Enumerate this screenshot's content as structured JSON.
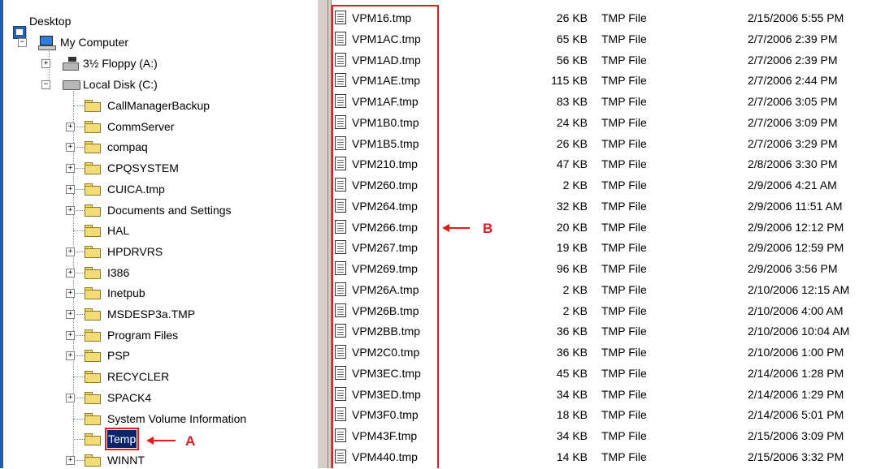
{
  "tree": {
    "desktop": "Desktop",
    "my_computer": "My Computer",
    "floppy": "3½ Floppy (A:)",
    "local_disk": "Local Disk (C:)",
    "folders": [
      {
        "label": "CallManagerBackup",
        "expandable": false
      },
      {
        "label": "CommServer",
        "expandable": true
      },
      {
        "label": "compaq",
        "expandable": true
      },
      {
        "label": "CPQSYSTEM",
        "expandable": true
      },
      {
        "label": "CUICA.tmp",
        "expandable": true
      },
      {
        "label": "Documents and Settings",
        "expandable": true
      },
      {
        "label": "HAL",
        "expandable": false
      },
      {
        "label": "HPDRVRS",
        "expandable": true
      },
      {
        "label": "I386",
        "expandable": true
      },
      {
        "label": "Inetpub",
        "expandable": true
      },
      {
        "label": "MSDESP3a.TMP",
        "expandable": true
      },
      {
        "label": "Program Files",
        "expandable": true
      },
      {
        "label": "PSP",
        "expandable": true
      },
      {
        "label": "RECYCLER",
        "expandable": false
      },
      {
        "label": "SPACK4",
        "expandable": true
      },
      {
        "label": "System Volume Information",
        "expandable": false
      },
      {
        "label": "Temp",
        "expandable": false,
        "selected": true
      },
      {
        "label": "WINNT",
        "expandable": true
      }
    ],
    "expander_plus": "+",
    "expander_minus": "−"
  },
  "files": [
    {
      "name": "VPM16.tmp",
      "size": "26 KB",
      "type": "TMP File",
      "modified": "2/15/2006 5:55 PM"
    },
    {
      "name": "VPM1AC.tmp",
      "size": "65 KB",
      "type": "TMP File",
      "modified": "2/7/2006 2:39 PM"
    },
    {
      "name": "VPM1AD.tmp",
      "size": "56 KB",
      "type": "TMP File",
      "modified": "2/7/2006 2:39 PM"
    },
    {
      "name": "VPM1AE.tmp",
      "size": "115 KB",
      "type": "TMP File",
      "modified": "2/7/2006 2:44 PM"
    },
    {
      "name": "VPM1AF.tmp",
      "size": "83 KB",
      "type": "TMP File",
      "modified": "2/7/2006 3:05 PM"
    },
    {
      "name": "VPM1B0.tmp",
      "size": "24 KB",
      "type": "TMP File",
      "modified": "2/7/2006 3:09 PM"
    },
    {
      "name": "VPM1B5.tmp",
      "size": "26 KB",
      "type": "TMP File",
      "modified": "2/7/2006 3:29 PM"
    },
    {
      "name": "VPM210.tmp",
      "size": "47 KB",
      "type": "TMP File",
      "modified": "2/8/2006 3:30 PM"
    },
    {
      "name": "VPM260.tmp",
      "size": "2 KB",
      "type": "TMP File",
      "modified": "2/9/2006 4:21 AM"
    },
    {
      "name": "VPM264.tmp",
      "size": "32 KB",
      "type": "TMP File",
      "modified": "2/9/2006 11:51 AM"
    },
    {
      "name": "VPM266.tmp",
      "size": "20 KB",
      "type": "TMP File",
      "modified": "2/9/2006 12:12 PM"
    },
    {
      "name": "VPM267.tmp",
      "size": "19 KB",
      "type": "TMP File",
      "modified": "2/9/2006 12:59 PM"
    },
    {
      "name": "VPM269.tmp",
      "size": "96 KB",
      "type": "TMP File",
      "modified": "2/9/2006 3:56 PM"
    },
    {
      "name": "VPM26A.tmp",
      "size": "2 KB",
      "type": "TMP File",
      "modified": "2/10/2006 12:15 AM"
    },
    {
      "name": "VPM26B.tmp",
      "size": "2 KB",
      "type": "TMP File",
      "modified": "2/10/2006 4:00 AM"
    },
    {
      "name": "VPM2BB.tmp",
      "size": "36 KB",
      "type": "TMP File",
      "modified": "2/10/2006 10:04 AM"
    },
    {
      "name": "VPM2C0.tmp",
      "size": "36 KB",
      "type": "TMP File",
      "modified": "2/10/2006 1:00 PM"
    },
    {
      "name": "VPM3EC.tmp",
      "size": "45 KB",
      "type": "TMP File",
      "modified": "2/14/2006 1:28 PM"
    },
    {
      "name": "VPM3ED.tmp",
      "size": "34 KB",
      "type": "TMP File",
      "modified": "2/14/2006 1:29 PM"
    },
    {
      "name": "VPM3F0.tmp",
      "size": "18 KB",
      "type": "TMP File",
      "modified": "2/14/2006 5:01 PM"
    },
    {
      "name": "VPM43F.tmp",
      "size": "34 KB",
      "type": "TMP File",
      "modified": "2/15/2006 3:09 PM"
    },
    {
      "name": "VPM440.tmp",
      "size": "14 KB",
      "type": "TMP File",
      "modified": "2/15/2006 3:32 PM"
    }
  ],
  "annotations": {
    "a": "A",
    "b": "B",
    "color": "#e21b1b"
  }
}
